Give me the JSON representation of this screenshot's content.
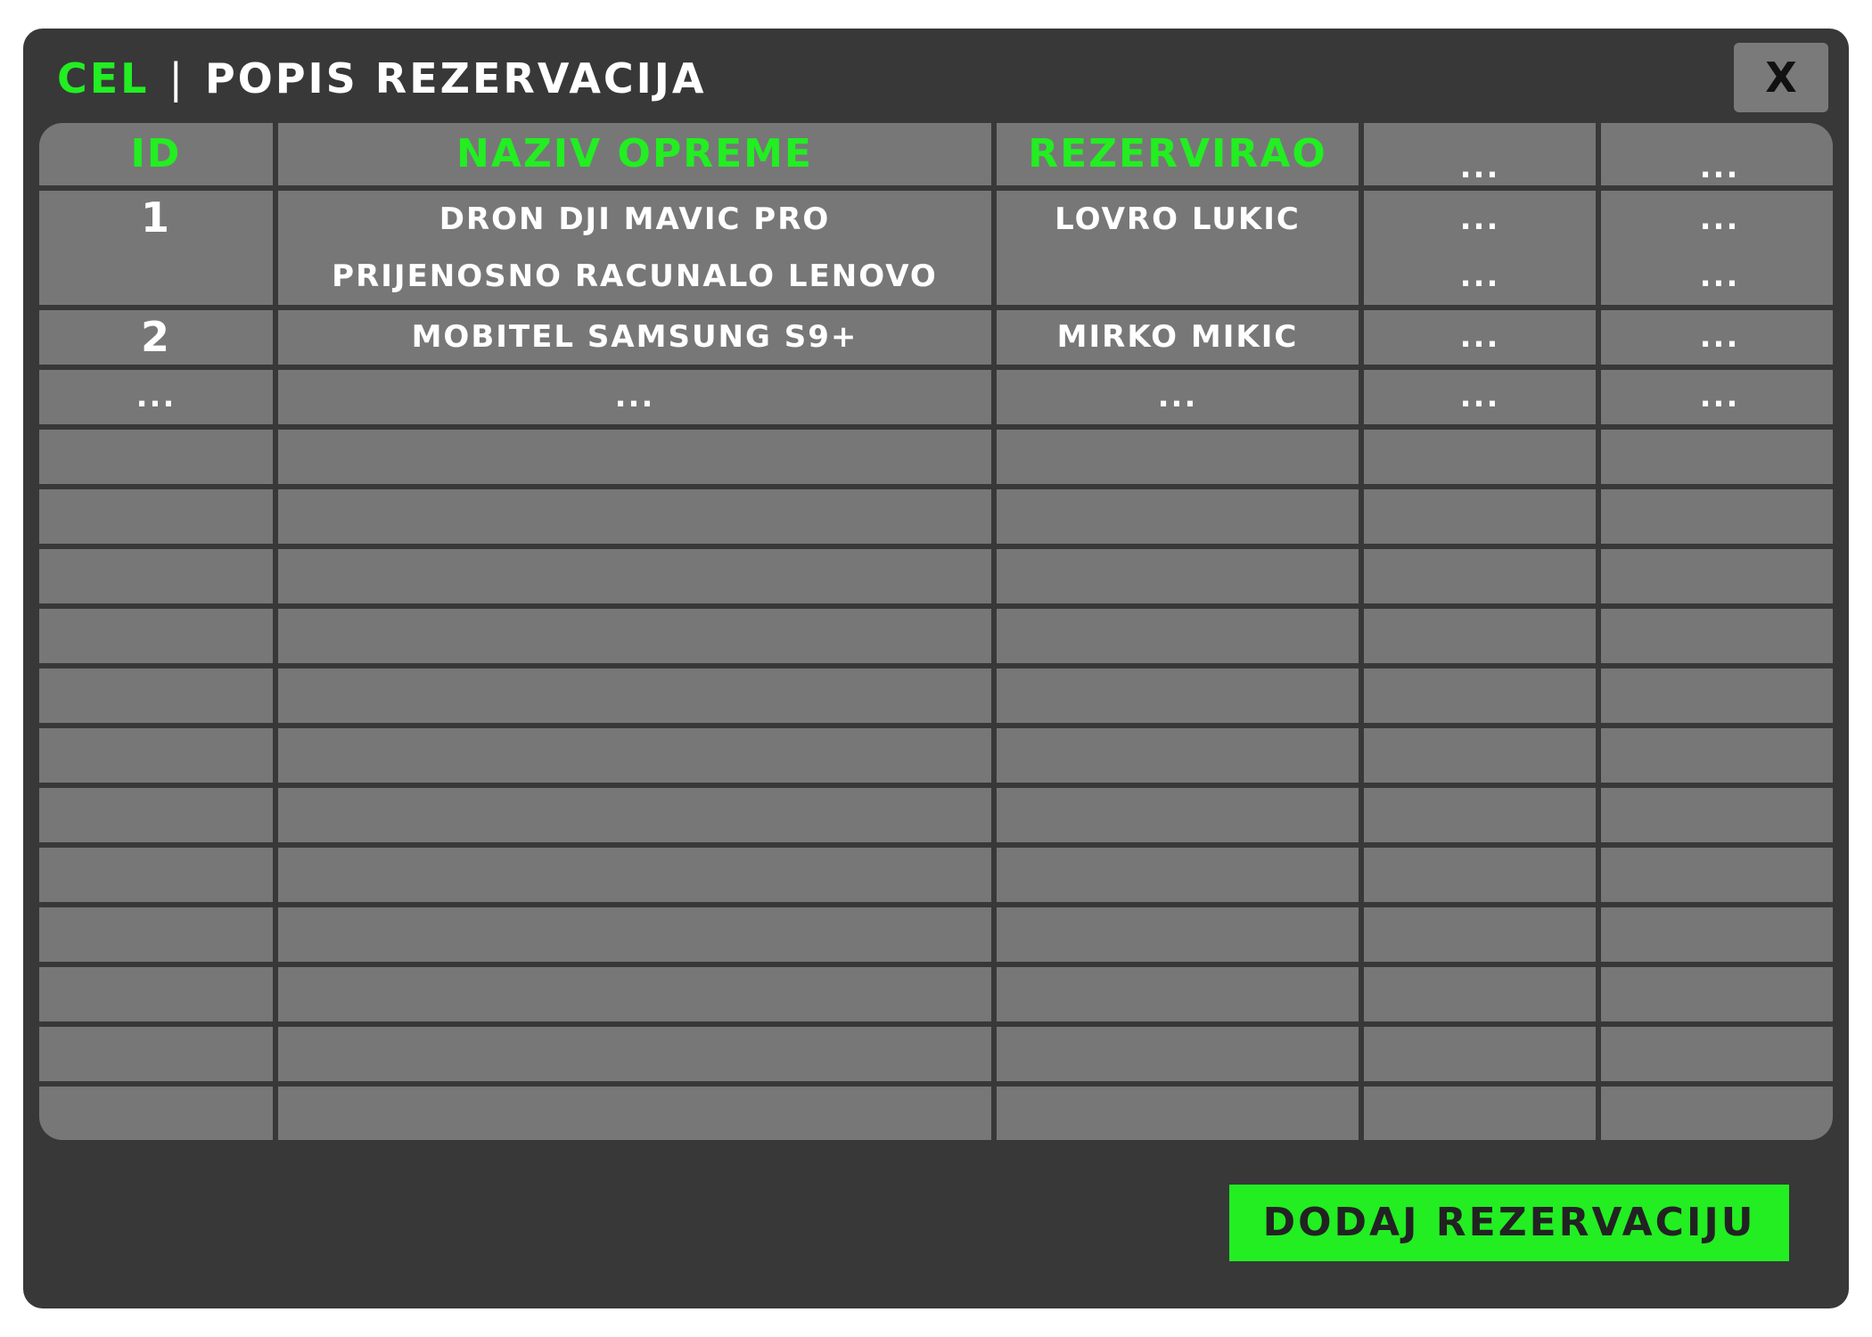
{
  "header": {
    "brand": "CEL",
    "separator": "|",
    "title": "POPIS REZERVACIJA",
    "close_label": "X"
  },
  "table": {
    "columns": [
      "ID",
      "NAZIV OPREME",
      "REZERVIRAO",
      "...",
      "..."
    ],
    "rows": [
      {
        "id": "1",
        "items": [
          "DRON DJI MAVIC PRO",
          "PRIJENOSNO RACUNALO LENOVO"
        ],
        "reserved_by": "LOVRO LUKIC",
        "col4": [
          "...",
          "..."
        ],
        "col5": [
          "...",
          "..."
        ]
      },
      {
        "id": "2",
        "item": "MOBITEL SAMSUNG S9+",
        "reserved_by": "MIRKO MIKIC",
        "col4": "...",
        "col5": "..."
      },
      {
        "id": "...",
        "item": "...",
        "reserved_by": "...",
        "col4": "...",
        "col5": "..."
      }
    ],
    "empty_rows": 12
  },
  "actions": {
    "add_label": "DODAJ REZERVACIJU"
  },
  "colors": {
    "accent": "#22ee22",
    "window_bg": "#383838",
    "cell_bg": "#777777"
  }
}
